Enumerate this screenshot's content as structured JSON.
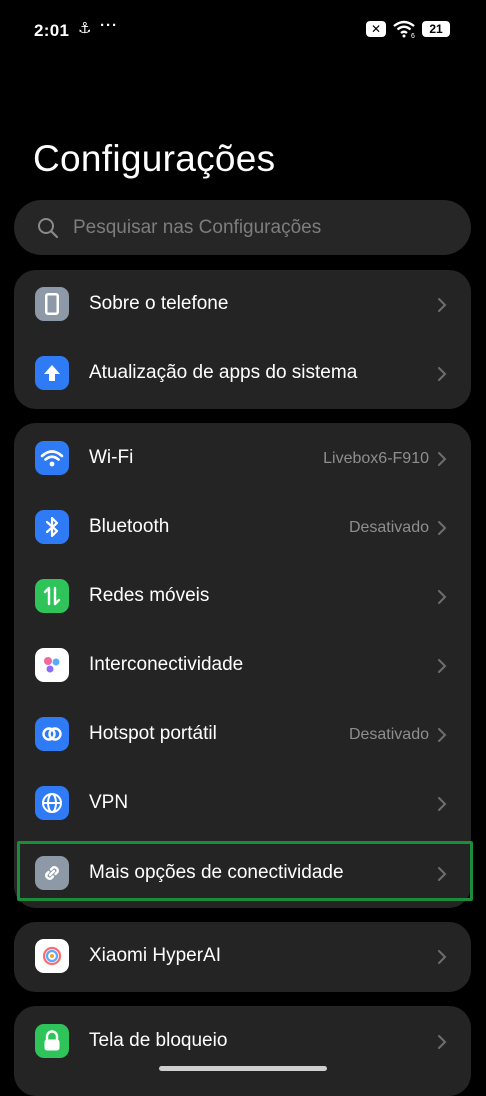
{
  "status_bar": {
    "time": "2:01",
    "wifi_sub": "6",
    "battery": "21"
  },
  "page_title": "Configurações",
  "search": {
    "placeholder": "Pesquisar nas Configurações"
  },
  "groups": [
    {
      "items": [
        {
          "label": "Sobre o telefone",
          "icon": "phone-icon",
          "value": ""
        },
        {
          "label": "Atualização de apps do sistema",
          "icon": "arrow-up-icon",
          "value": ""
        }
      ]
    },
    {
      "items": [
        {
          "label": "Wi-Fi",
          "icon": "wifi-icon",
          "value": "Livebox6-F910"
        },
        {
          "label": "Bluetooth",
          "icon": "bluetooth-icon",
          "value": "Desativado"
        },
        {
          "label": "Redes móveis",
          "icon": "mobile-data-icon",
          "value": ""
        },
        {
          "label": "Interconectividade",
          "icon": "interconnect-icon",
          "value": ""
        },
        {
          "label": "Hotspot portátil",
          "icon": "hotspot-icon",
          "value": "Desativado"
        },
        {
          "label": "VPN",
          "icon": "globe-icon",
          "value": ""
        },
        {
          "label": "Mais opções de conectividade",
          "icon": "link-icon",
          "value": ""
        }
      ]
    },
    {
      "items": [
        {
          "label": "Xiaomi HyperAI",
          "icon": "hyperai-icon",
          "value": ""
        }
      ]
    },
    {
      "items": [
        {
          "label": "Tela de bloqueio",
          "icon": "lock-icon",
          "value": ""
        }
      ]
    }
  ],
  "colors": {
    "background": "#000000",
    "card": "#242424",
    "accent_blue": "#2f7bf6",
    "green": "#2fc45a",
    "highlight": "#1a8c3a"
  }
}
